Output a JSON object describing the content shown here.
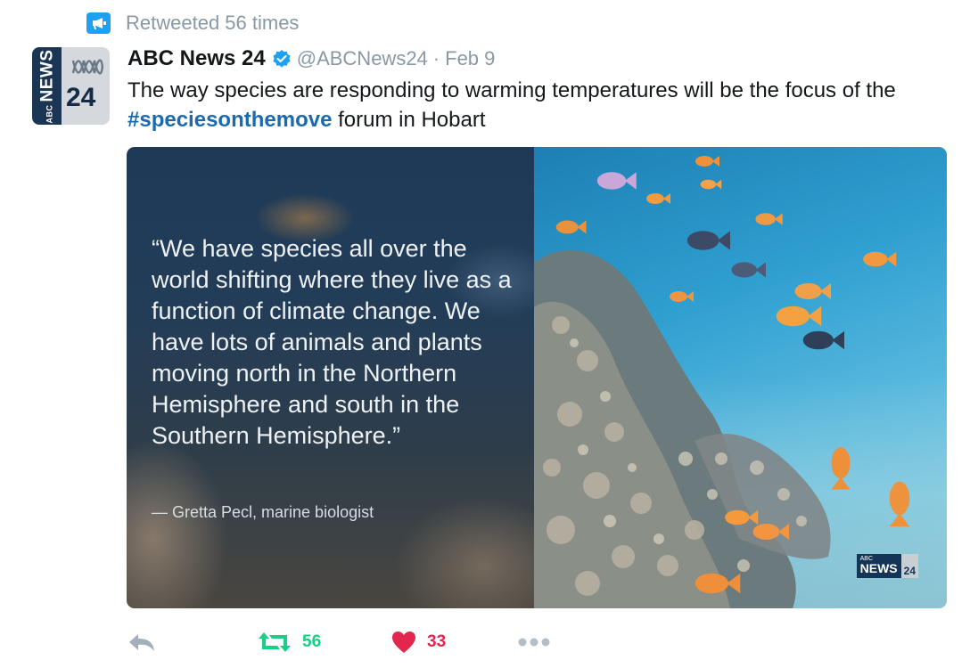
{
  "retweet_context": {
    "text": "Retweeted 56 times",
    "icon": "megaphone-icon",
    "color": "#1da1f2"
  },
  "tweet": {
    "author": {
      "name": "ABC News 24",
      "handle": "@ABCNews24",
      "verified": true,
      "avatar": {
        "word": "NEWS",
        "small_word": "ABC",
        "number": "24"
      }
    },
    "separator": "·",
    "date": "Feb 9",
    "text_before": "The way species are responding to warming temperatures will be the focus of the ",
    "hashtag": "#speciesonthemove",
    "text_after": " forum in Hobart"
  },
  "media": {
    "quote": "“We have species all over the world shifting where they live as a function of climate change. We have lots of animals and plants moving north in the Northern Hemisphere and south in the Southern Hemisphere.”",
    "attribution": "— Gretta Pecl, marine biologist",
    "logo": {
      "small": "ABC",
      "word": "NEWS",
      "number": "24"
    }
  },
  "actions": {
    "reply": {
      "icon": "reply-icon"
    },
    "retweet": {
      "icon": "retweet-icon",
      "count": "56",
      "color": "#19cf86"
    },
    "like": {
      "icon": "heart-icon",
      "count": "33",
      "color": "#e2264d"
    },
    "more": {
      "icon": "more-icon"
    }
  },
  "colors": {
    "text": "#14171a",
    "muted": "#8899a6",
    "link": "#1b6ab0"
  }
}
